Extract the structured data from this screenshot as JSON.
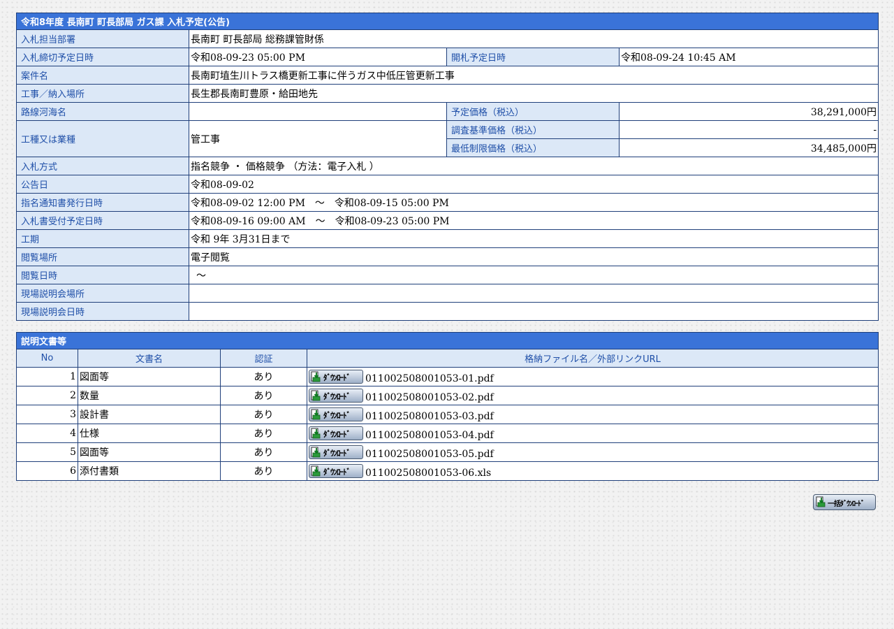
{
  "info": {
    "title": "令和8年度 長南町 町長部局 ガス課 入札予定(公告)",
    "rows": {
      "dept": {
        "label": "入札担当部署",
        "value": "長南町 町長部局 総務課管財係"
      },
      "deadline": {
        "label": "入札締切予定日時",
        "value": "令和08-09-23 05:00 PM",
        "open_label": "開札予定日時",
        "open_value": "令和08-09-24 10:45 AM"
      },
      "name": {
        "label": "案件名",
        "value": "長南町埴生川トラス橋更新工事に伴うガス中低圧管更新工事"
      },
      "place": {
        "label": "工事／納入場所",
        "value": "長生郡長南町豊原・給田地先"
      },
      "route": {
        "label": "路線河海名",
        "value": "",
        "price_label": "予定価格（税込）",
        "price_value": "38,291,000円"
      },
      "type": {
        "label": "工種又は業種",
        "value": "管工事",
        "survey_label": "調査基準価格（税込）",
        "survey_value": "-",
        "min_label": "最低制限価格（税込）",
        "min_value": "34,485,000円"
      },
      "method": {
        "label": "入札方式",
        "value": "指名競争 ・ 価格競争 （方法：電子入札 ）"
      },
      "notice": {
        "label": "公告日",
        "value": "令和08-09-02"
      },
      "nomination": {
        "label": "指名通知書発行日時",
        "value": "令和08-09-02 12:00 PM　～　令和08-09-15 05:00 PM"
      },
      "reception": {
        "label": "入札書受付予定日時",
        "value": "令和08-09-16 09:00 AM　～　令和08-09-23 05:00 PM"
      },
      "period": {
        "label": "工期",
        "value": "令和 9年 3月31日まで"
      },
      "view_place": {
        "label": "閲覧場所",
        "value": "電子閲覧"
      },
      "view_time": {
        "label": "閲覧日時",
        "value": "～"
      },
      "site_place": {
        "label": "現場説明会場所",
        "value": ""
      },
      "site_time": {
        "label": "現場説明会日時",
        "value": ""
      }
    }
  },
  "docs": {
    "title": "説明文書等",
    "headers": {
      "no": "No",
      "name": "文書名",
      "auth": "認証",
      "file": "格納ファイル名／外部リンクURL"
    },
    "download_label": "ﾀﾞｳﾝﾛｰﾄﾞ",
    "items": [
      {
        "no": "1",
        "name": "図面等",
        "auth": "あり",
        "file": "011002508001053-01.pdf"
      },
      {
        "no": "2",
        "name": "数量",
        "auth": "あり",
        "file": "011002508001053-02.pdf"
      },
      {
        "no": "3",
        "name": "設計書",
        "auth": "あり",
        "file": "011002508001053-03.pdf"
      },
      {
        "no": "4",
        "name": "仕様",
        "auth": "あり",
        "file": "011002508001053-04.pdf"
      },
      {
        "no": "5",
        "name": "図面等",
        "auth": "あり",
        "file": "011002508001053-05.pdf"
      },
      {
        "no": "6",
        "name": "添付書類",
        "auth": "あり",
        "file": "011002508001053-06.xls"
      }
    ]
  },
  "bulk_download_label": "一括ﾀﾞｳﾝﾛｰﾄﾞ",
  "colors": {
    "header_blue": "#3a73d8",
    "label_bg": "#dce8f7",
    "label_text": "#1f4fa8",
    "border": "#1f3f7a"
  }
}
